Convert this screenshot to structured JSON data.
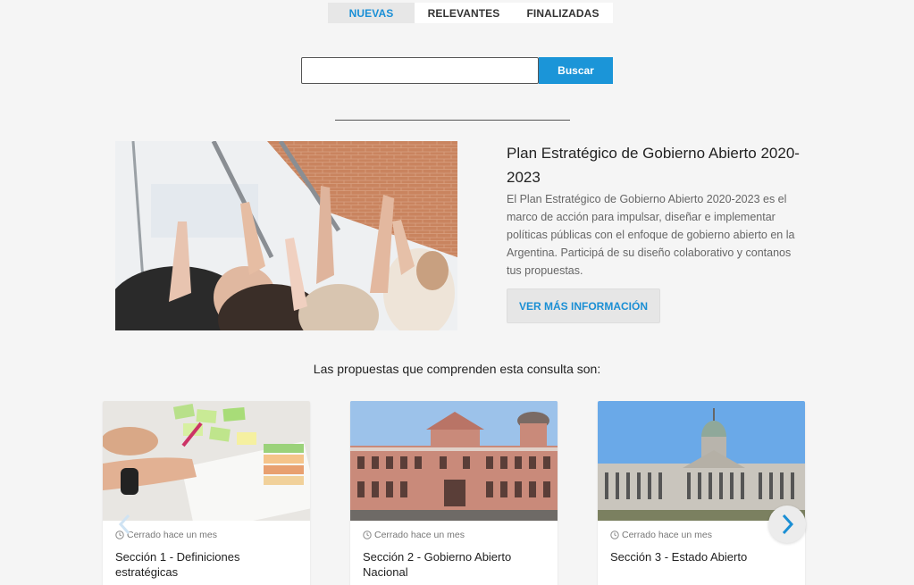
{
  "tabs": [
    {
      "label": "NUEVAS",
      "active": true
    },
    {
      "label": "RELEVANTES",
      "active": false
    },
    {
      "label": "FINALIZADAS",
      "active": false
    }
  ],
  "search": {
    "value": "",
    "placeholder": "",
    "button_label": "Buscar"
  },
  "hero": {
    "title": "Plan Estratégico de Gobierno Abierto 2020-2023",
    "description": "El Plan Estratégico de Gobierno Abierto 2020-2023 es el marco de acción para impulsar, diseñar e implementar políticas públicas con el enfoque de gobierno abierto en la Argentina. Participá de su diseño colaborativo y contanos tus propuestas.",
    "button_label": "VER MÁS INFORMACIÓN"
  },
  "proposals": {
    "heading": "Las propuestas que comprenden esta consulta son:",
    "cards": [
      {
        "status": "Cerrado hace un mes",
        "title": "Sección 1 - Definiciones estratégicas"
      },
      {
        "status": "Cerrado hace un mes",
        "title": "Sección 2 - Gobierno Abierto Nacional"
      },
      {
        "status": "Cerrado hace un mes",
        "title": "Sección 3 - Estado Abierto"
      }
    ]
  },
  "colors": {
    "accent": "#1b95d8",
    "background": "#f5f5f5"
  },
  "icons": {
    "prev": "chevron-left-icon",
    "next": "chevron-right-icon",
    "status": "clock-icon"
  }
}
